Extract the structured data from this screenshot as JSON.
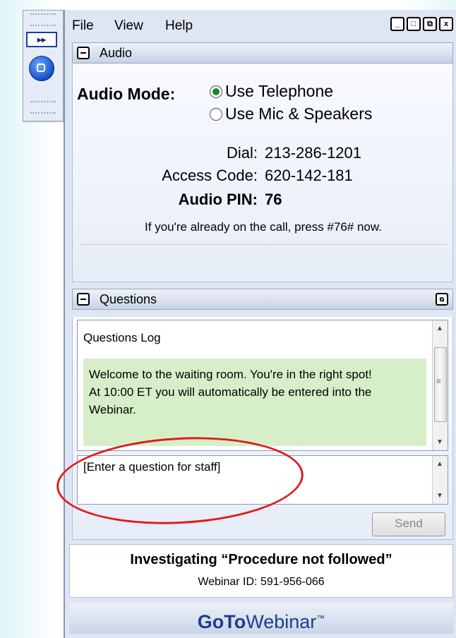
{
  "mini_toolbar": {
    "forward_label": "▸▸"
  },
  "menu": [
    "File",
    "View",
    "Help"
  ],
  "window_buttons": [
    "_",
    "□",
    "⧉",
    "x"
  ],
  "audio": {
    "header": "Audio",
    "mode_label": "Audio Mode:",
    "options": [
      {
        "label": "Use Telephone",
        "selected": true
      },
      {
        "label": "Use Mic & Speakers",
        "selected": false
      }
    ],
    "dial_label": "Dial:",
    "dial_value": "213-286-1201",
    "access_label": "Access Code:",
    "access_value": "620-142-181",
    "pin_label": "Audio PIN:",
    "pin_value": "76",
    "note": "If you're already on the call, press #76# now."
  },
  "questions": {
    "header": "Questions",
    "log_title": "Questions Log",
    "message_line1": "Welcome to the waiting room.  You're in the right spot!",
    "message_line2": "At 10:00 ET you will automatically be entered into the Webinar.",
    "input_value": "[Enter a question for staff]",
    "send_label": "Send"
  },
  "webinar": {
    "title": "Investigating “Procedure not followed”",
    "id_line": "Webinar ID: 591-956-066"
  },
  "brand": {
    "part1": "GoTo",
    "part2": "Webinar",
    "tm": "™"
  },
  "colors": {
    "annotation": "#e11b1b",
    "message_bg": "#d7efc8",
    "accent": "#1b3e8f"
  }
}
